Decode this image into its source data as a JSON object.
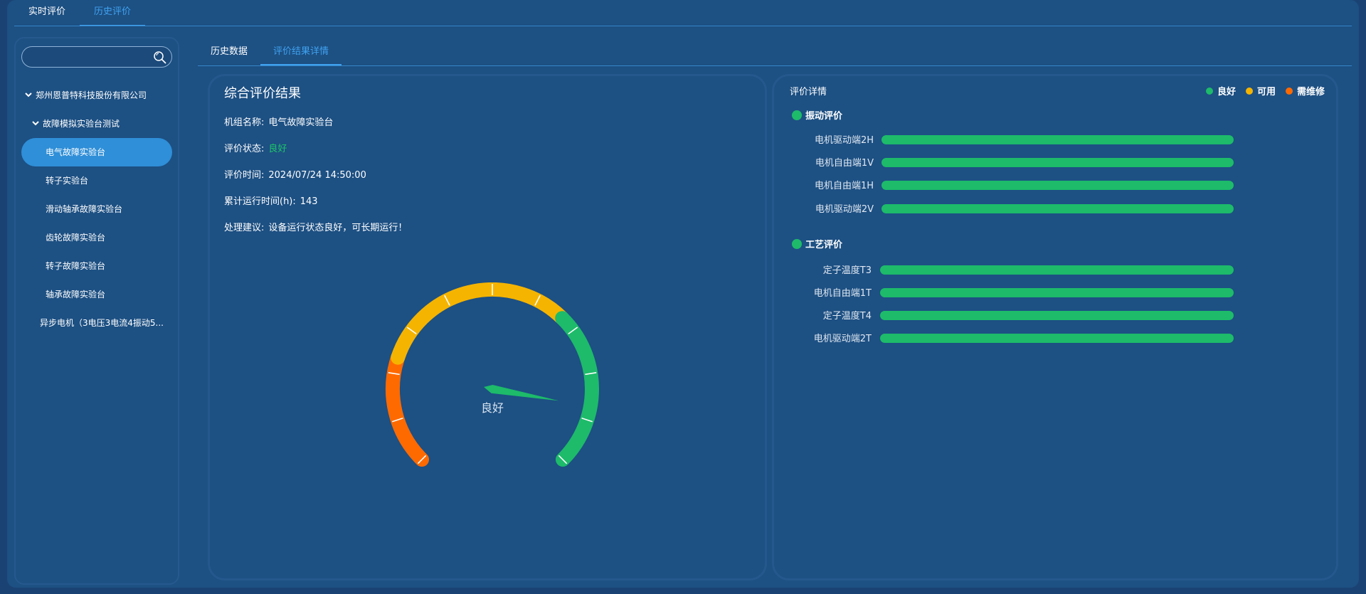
{
  "top_tabs": [
    {
      "label": "实时评价"
    },
    {
      "label": "历史评价"
    }
  ],
  "sidebar": {
    "search_placeholder": "",
    "tree": [
      {
        "label": "郑州恩普特科技股份有限公司",
        "expanded": true
      },
      {
        "label": "故障模拟实验台测试",
        "expanded": true
      },
      {
        "label": "电气故障实验台",
        "selected": true
      },
      {
        "label": "转子实验台"
      },
      {
        "label": "滑动轴承故障实验台"
      },
      {
        "label": "齿轮故障实验台"
      },
      {
        "label": "转子故障实验台"
      },
      {
        "label": "轴承故障实验台"
      },
      {
        "label": "异步电机（3电压3电流4振动5..."
      }
    ]
  },
  "sub_tabs": [
    {
      "label": "历史数据"
    },
    {
      "label": "评价结果详情"
    }
  ],
  "result": {
    "title": "综合评价结果",
    "rows": [
      {
        "label": "机组名称:",
        "value": "电气故障实验台"
      },
      {
        "label": "评价状态:",
        "value": "良好"
      },
      {
        "label": "评价时间:",
        "value": "2024/07/24 14:50:00"
      },
      {
        "label": "累计运行时间(h):",
        "value": "143"
      },
      {
        "label": "处理建议:",
        "value": "设备运行状态良好，可长期运行！"
      }
    ],
    "gauge": {
      "label": "良好",
      "value_fraction": 0.87,
      "colors": {
        "need_repair": "#ff6a00",
        "usable": "#f5b400",
        "good": "#1dbb6a"
      }
    }
  },
  "detail": {
    "title": "评价详情",
    "legend": [
      {
        "label": "良好",
        "color": "#1dbb6a"
      },
      {
        "label": "可用",
        "color": "#f5b400"
      },
      {
        "label": "需维修",
        "color": "#ff6a00"
      }
    ],
    "sections": [
      {
        "title": "振动评价",
        "items": [
          {
            "label": "电机驱动端2H",
            "fraction": 1.0
          },
          {
            "label": "电机自由端1V",
            "fraction": 1.0
          },
          {
            "label": "电机自由端1H",
            "fraction": 1.0
          },
          {
            "label": "电机驱动端2V",
            "fraction": 1.0
          }
        ]
      },
      {
        "title": "工艺评价",
        "items": [
          {
            "label": "定子温度T3",
            "fraction": 1.0
          },
          {
            "label": "电机自由端1T",
            "fraction": 1.0
          },
          {
            "label": "定子温度T4",
            "fraction": 1.0
          },
          {
            "label": "电机驱动端2T",
            "fraction": 1.0
          }
        ]
      }
    ]
  }
}
